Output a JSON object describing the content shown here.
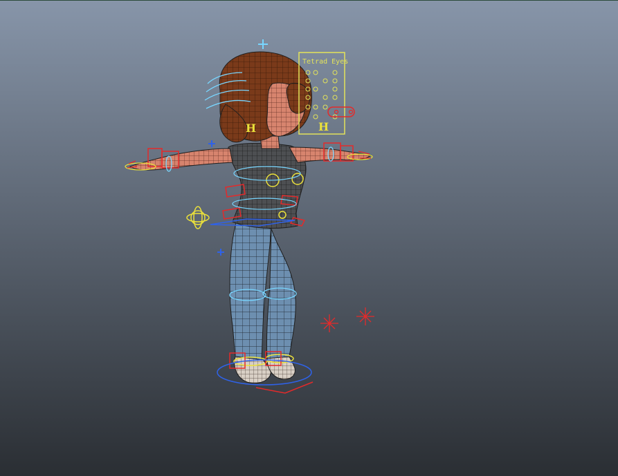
{
  "viewport": {
    "background_top": "#8795a9",
    "background_bottom": "#2a2e33",
    "border_color": "#2a4a3a"
  },
  "rig_panel": {
    "title": "Tetrad Eyes",
    "color": "#e3e35a"
  },
  "rig_labels": {
    "left_hair_marker": "H",
    "right_hair_marker": "H"
  },
  "colors": {
    "hair": "#7a3a1a",
    "skin": "#d7846e",
    "shirt": "#4d4f52",
    "jeans": "#6d8fb0",
    "shoes": "#d8cfc5",
    "wire": "#1f1f1f",
    "control_red": "#e42a2a",
    "control_yellow": "#ebe13a",
    "control_cyan": "#78d6ff",
    "control_blue": "#2f62e8"
  }
}
